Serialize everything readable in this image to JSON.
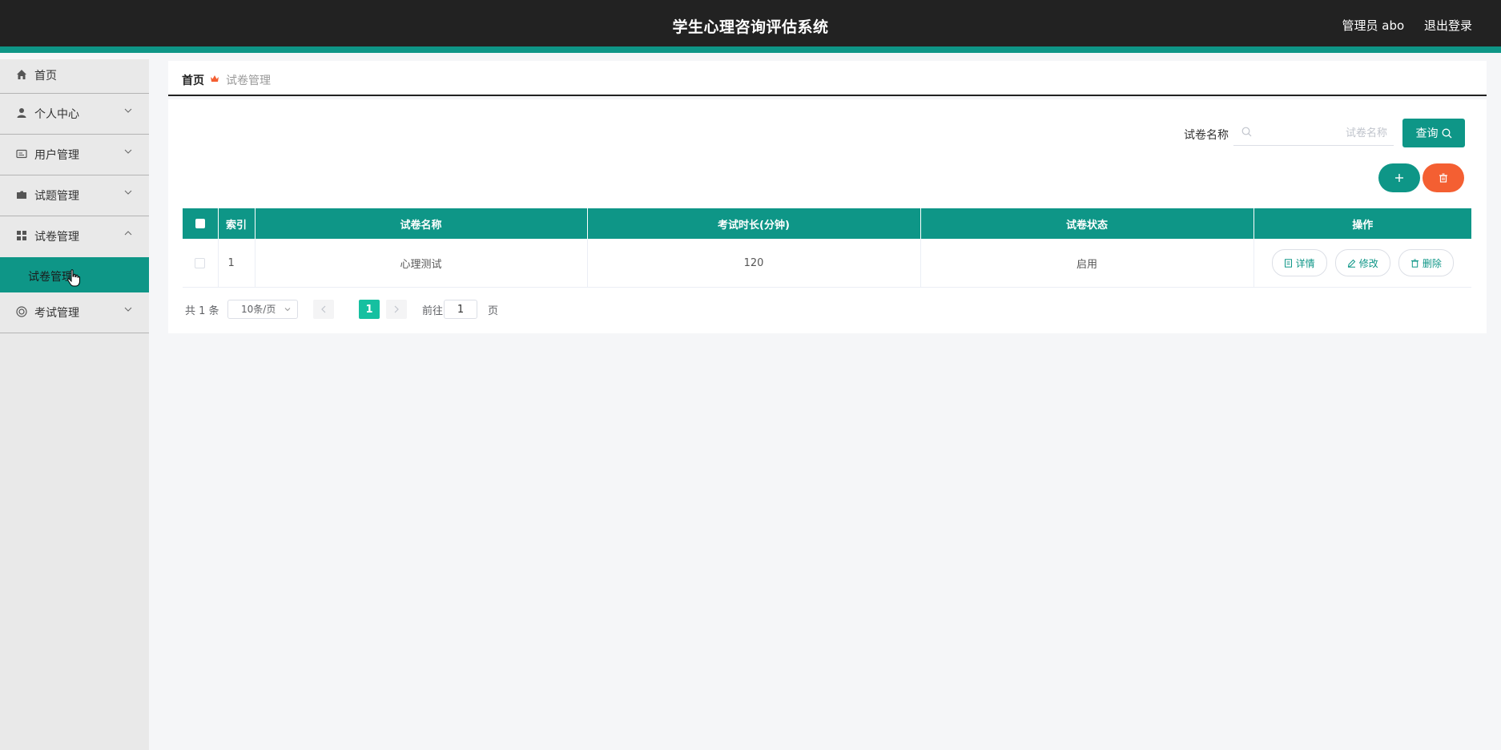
{
  "header": {
    "title": "学生心理咨询评估系统",
    "user": "管理员 abo",
    "logout": "退出登录"
  },
  "sidebar": {
    "items": [
      {
        "label": "首页",
        "icon": "home-icon"
      },
      {
        "label": "个人中心",
        "icon": "person-icon"
      },
      {
        "label": "用户管理",
        "icon": "id-card-icon"
      },
      {
        "label": "试题管理",
        "icon": "folder-icon"
      },
      {
        "label": "试卷管理",
        "icon": "grid-icon",
        "expanded": true
      },
      {
        "label": "考试管理",
        "icon": "target-icon"
      }
    ],
    "active_sub": "试卷管理"
  },
  "breadcrumb": {
    "home": "首页",
    "current": "试卷管理"
  },
  "search": {
    "label": "试卷名称",
    "placeholder": "试卷名称",
    "button": "查询"
  },
  "table": {
    "headers": [
      "索引",
      "试卷名称",
      "考试时长(分钟)",
      "试卷状态",
      "操作"
    ],
    "rows": [
      {
        "index": "1",
        "name": "心理测试",
        "duration": "120",
        "status": "启用"
      }
    ],
    "actions": {
      "detail": "详情",
      "edit": "修改",
      "delete": "删除"
    }
  },
  "pagination": {
    "total": "共 1 条",
    "page_size": "10条/页",
    "current_page": "1",
    "goto_label": "前往",
    "goto_value": "1",
    "page_unit": "页"
  },
  "colors": {
    "primary": "#0e9687",
    "danger": "#f45f32",
    "header_bg": "#222222",
    "page_active": "#16c0a0"
  }
}
